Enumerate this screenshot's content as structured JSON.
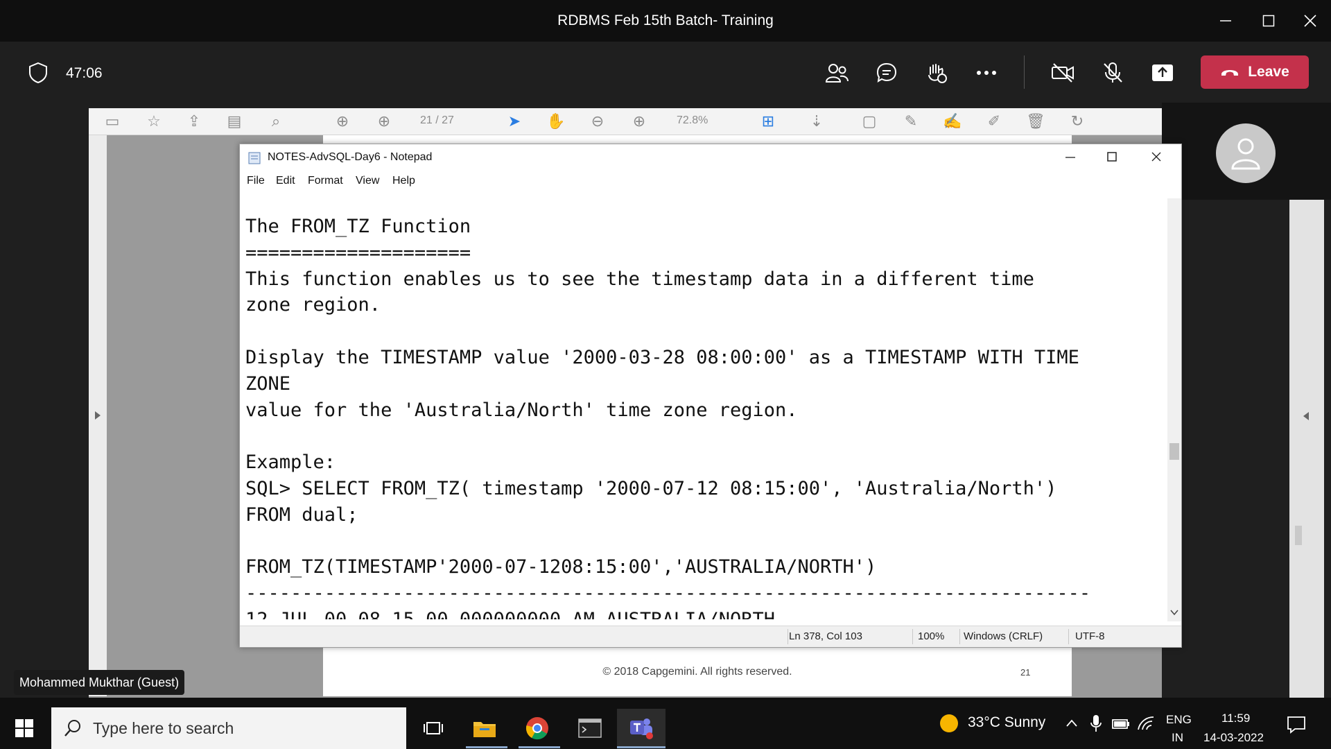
{
  "window": {
    "title": "RDBMS Feb 15th Batch- Training"
  },
  "meeting": {
    "timer": "47:06",
    "leave_label": "Leave",
    "participant_name": "Mohammed Mukthar (Guest)"
  },
  "pdf": {
    "page_indicator": "21 / 27",
    "zoom": "72.8%",
    "footer_copyright": "© 2018 Capgemini. All rights reserved.",
    "footer_page": "21"
  },
  "notepad": {
    "title": "NOTES-AdvSQL-Day6 - Notepad",
    "menu": [
      "File",
      "Edit",
      "Format",
      "View",
      "Help"
    ],
    "text": "The FROM_TZ Function\n====================\nThis function enables us to see the timestamp data in a different time\nzone region.\n\nDisplay the TIMESTAMP value '2000-03-28 08:00:00' as a TIMESTAMP WITH TIME\nZONE\nvalue for the 'Australia/North' time zone region.\n\nExample:\nSQL> SELECT FROM_TZ( timestamp '2000-07-12 08:15:00', 'Australia/North')\nFROM dual;\n\nFROM_TZ(TIMESTAMP'2000-07-1208:15:00','AUSTRALIA/NORTH')\n---------------------------------------------------------------------------\n12-JUL-00 08.15.00.000000000 AM AUSTRALIA/NORTH",
    "status": {
      "position": "Ln 378, Col 103",
      "zoom": "100%",
      "line_ending": "Windows (CRLF)",
      "encoding": "UTF-8"
    }
  },
  "taskbar": {
    "search_placeholder": "Type here to search",
    "weather": "33°C  Sunny",
    "lang_top": "ENG",
    "lang_bottom": "IN",
    "time": "11:59",
    "date": "14-03-2022"
  },
  "colors": {
    "leave": "#c4314b",
    "titlebar": "#0f0f0f",
    "teams": "#5b5fc7"
  }
}
